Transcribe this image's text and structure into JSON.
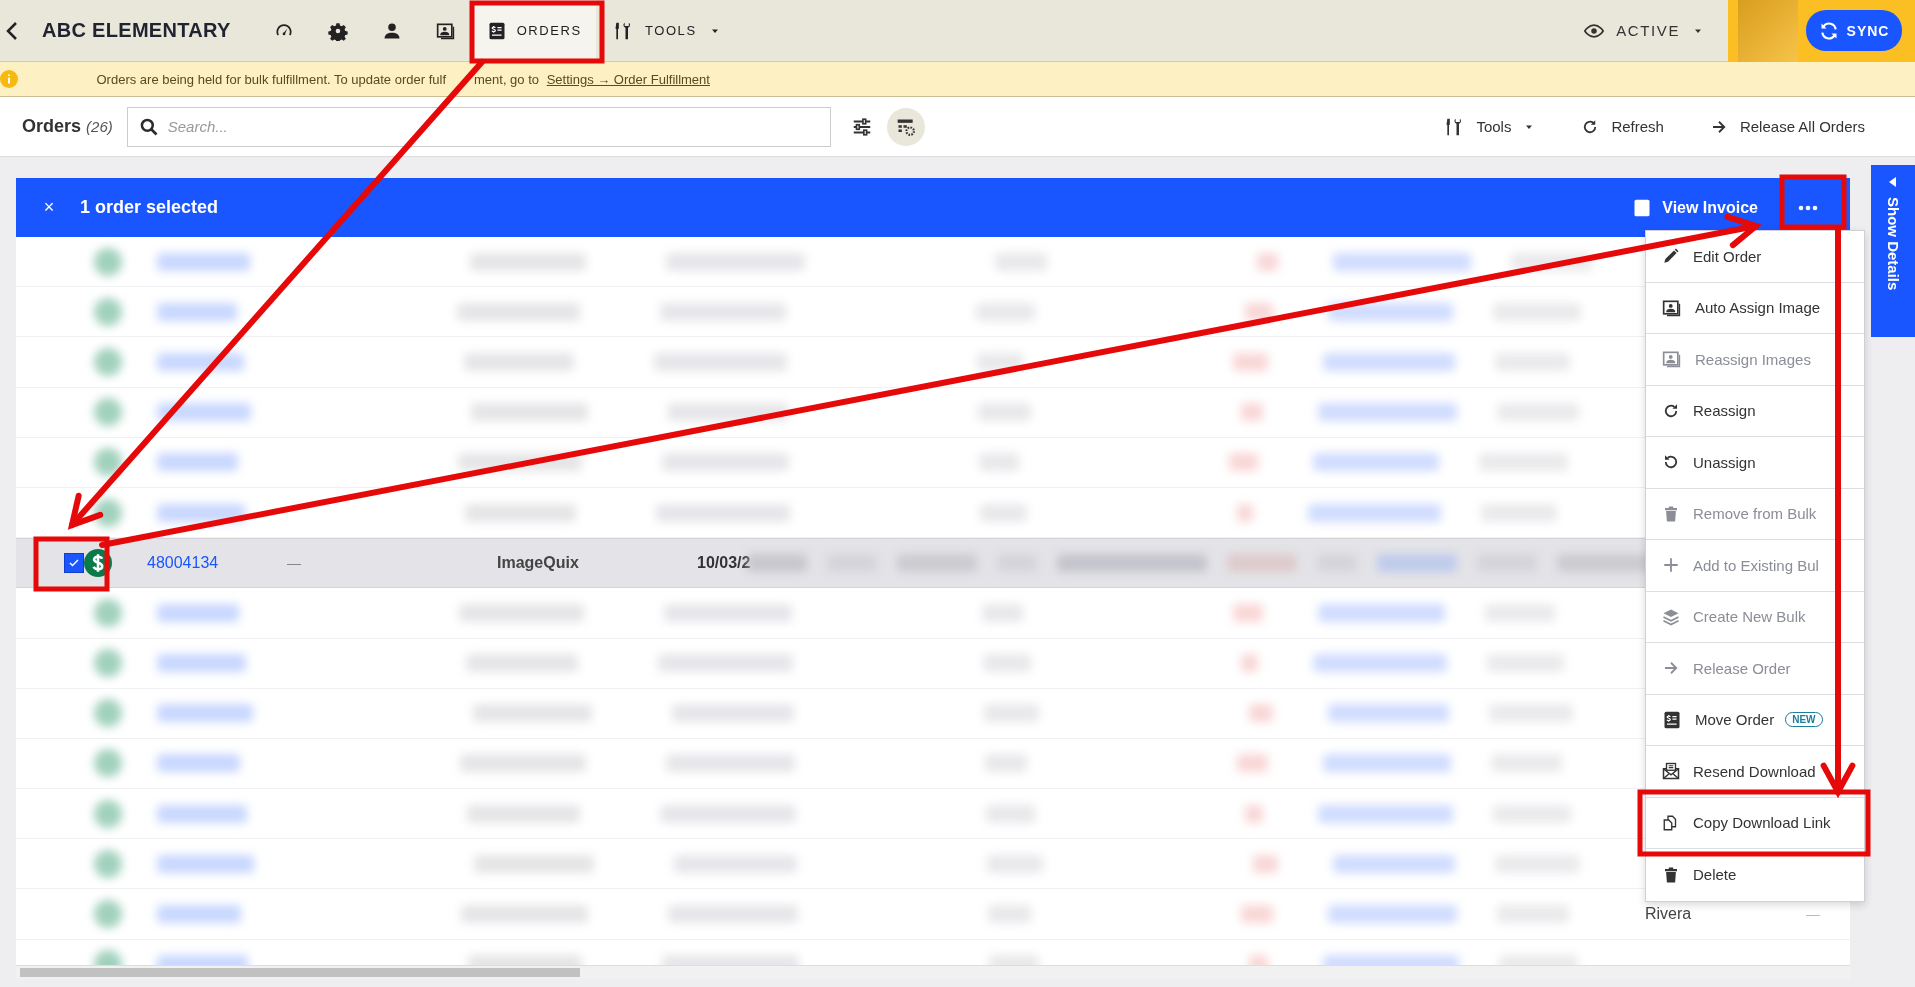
{
  "nav": {
    "title": "ABC ELEMENTARY",
    "tabs": [
      {
        "kind": "icon",
        "selected": false
      },
      {
        "kind": "icon",
        "selected": false
      },
      {
        "kind": "icon",
        "selected": false
      },
      {
        "kind": "icon",
        "selected": false
      },
      {
        "kind": "text",
        "label": "ORDERS",
        "selected": true
      },
      {
        "kind": "dropdown",
        "label": "TOOLS",
        "selected": false
      }
    ],
    "status": "ACTIVE",
    "sync": "SYNC"
  },
  "banner": {
    "text_parts": [
      "Orders are being held for bulk fulfillment. To update order fulf",
      "ment, go to"
    ],
    "link": "Settings → Order Fulfillment"
  },
  "toolbar": {
    "title": "Orders",
    "count": "(26)",
    "search": {
      "placeholder": "Search..."
    },
    "actions": [
      {
        "kind": "dropdown",
        "label": "Tools"
      },
      {
        "kind": "refresh",
        "label": "Refresh"
      },
      {
        "kind": "release",
        "label": "Release All Orders"
      }
    ]
  },
  "selection": {
    "close": "×",
    "label": "1 order selected",
    "action": "View Invoice"
  },
  "side_tab": {
    "label": "Show Details"
  },
  "menu": {
    "items": [
      {
        "label": "Edit Order",
        "disabled": false
      },
      {
        "label": "Auto Assign Image",
        "disabled": false
      },
      {
        "label": "Reassign Images",
        "disabled": true
      },
      {
        "label": "Reassign",
        "disabled": false
      },
      {
        "label": "Unassign",
        "disabled": false
      },
      {
        "label": "Remove from Bulk",
        "disabled": true
      },
      {
        "label": "Add to Existing Bul",
        "disabled": true
      },
      {
        "label": "Create New Bulk",
        "disabled": true
      },
      {
        "label": "Release Order",
        "disabled": true
      },
      {
        "label": "Move Order",
        "disabled": false,
        "badge": "NEW"
      },
      {
        "label": "Resend Download",
        "disabled": false
      },
      {
        "label": "Copy Download Link",
        "disabled": false
      },
      {
        "label": "Delete",
        "disabled": false
      }
    ]
  },
  "table": {
    "rows": [
      {
        "kind": "blurred",
        "selected": false
      },
      {
        "kind": "blurred",
        "selected": false
      },
      {
        "kind": "blurred",
        "selected": false
      },
      {
        "kind": "blurred",
        "selected": false
      },
      {
        "kind": "blurred",
        "selected": false
      },
      {
        "kind": "blurred",
        "selected": false
      },
      {
        "kind": "order",
        "selected": true,
        "checked": true,
        "order_number": "48004134",
        "column_4": "—",
        "source": "ImageQuix",
        "date": "10/03/2"
      },
      {
        "kind": "blurred",
        "selected": false
      },
      {
        "kind": "blurred",
        "selected": false
      },
      {
        "kind": "blurred",
        "selected": false
      },
      {
        "kind": "blurred",
        "selected": false
      },
      {
        "kind": "blurred",
        "selected": false
      },
      {
        "kind": "blurred",
        "selected": false
      },
      {
        "kind": "blurred",
        "selected": false,
        "name": "Rivera",
        "column_last": "—"
      },
      {
        "kind": "blurred",
        "selected": false
      }
    ]
  }
}
